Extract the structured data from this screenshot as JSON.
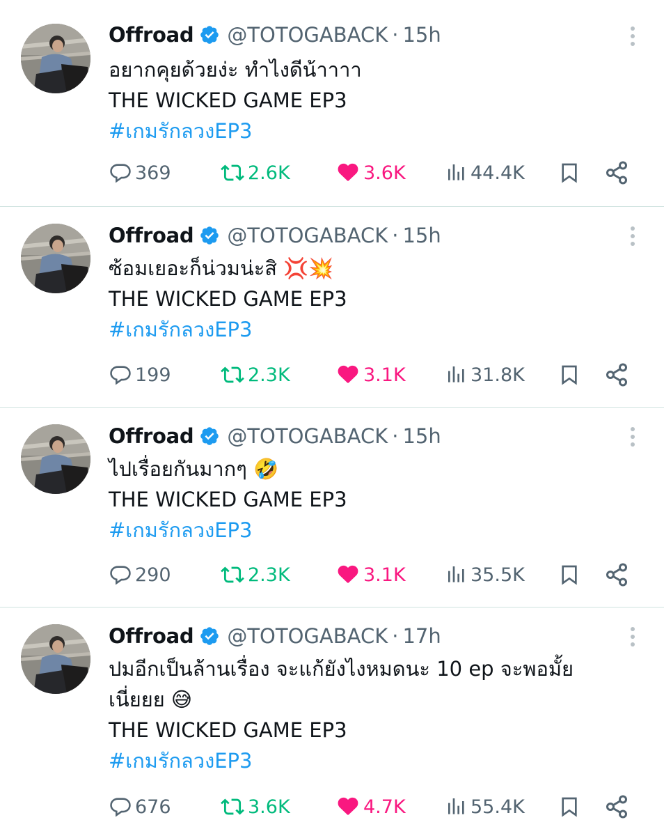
{
  "tweets": [
    {
      "name": "Offroad",
      "handle": "@TOTOGABACK",
      "separator": "·",
      "time": "15h",
      "lines": [
        "อยากคุยด้วยง่ะ ทำไงดีน้าาาา",
        "THE WICKED GAME EP3"
      ],
      "hashtag": "#เกมรักลวงEP3",
      "emoji": "",
      "replies": "369",
      "retweets": "2.6K",
      "likes": "3.6K",
      "views": "44.4K"
    },
    {
      "name": "Offroad",
      "handle": "@TOTOGABACK",
      "separator": "·",
      "time": "15h",
      "lines": [
        "ซ้อมเยอะก็น่วมน่ะสิ 💢💥",
        "THE WICKED GAME EP3"
      ],
      "hashtag": "#เกมรักลวงEP3",
      "emoji": "",
      "replies": "199",
      "retweets": "2.3K",
      "likes": "3.1K",
      "views": "31.8K"
    },
    {
      "name": "Offroad",
      "handle": "@TOTOGABACK",
      "separator": "·",
      "time": "15h",
      "lines": [
        "ไปเรื่อยกันมากๆ 🤣",
        "THE WICKED GAME EP3"
      ],
      "hashtag": "#เกมรักลวงEP3",
      "emoji": "",
      "replies": "290",
      "retweets": "2.3K",
      "likes": "3.1K",
      "views": "35.5K"
    },
    {
      "name": "Offroad",
      "handle": "@TOTOGABACK",
      "separator": "·",
      "time": "17h",
      "lines": [
        "ปมอีกเป็นล้านเรื่อง จะแก้ยังไงหมดนะ 10 ep จะพอมั้ย",
        "เนี่ยยย 😅",
        "THE WICKED GAME EP3"
      ],
      "hashtag": "#เกมรักลวงEP3",
      "emoji": "",
      "replies": "676",
      "retweets": "3.6K",
      "likes": "4.7K",
      "views": "55.4K"
    }
  ],
  "colors": {
    "link": "#1d9bf0",
    "retweet": "#00ba7c",
    "like": "#f91880",
    "muted": "#536471",
    "verified": "#1d9bf0"
  },
  "icons": [
    "reply-icon",
    "retweet-icon",
    "like-icon",
    "views-icon",
    "bookmark-icon",
    "share-icon",
    "verified-badge-icon",
    "more-options-icon"
  ]
}
